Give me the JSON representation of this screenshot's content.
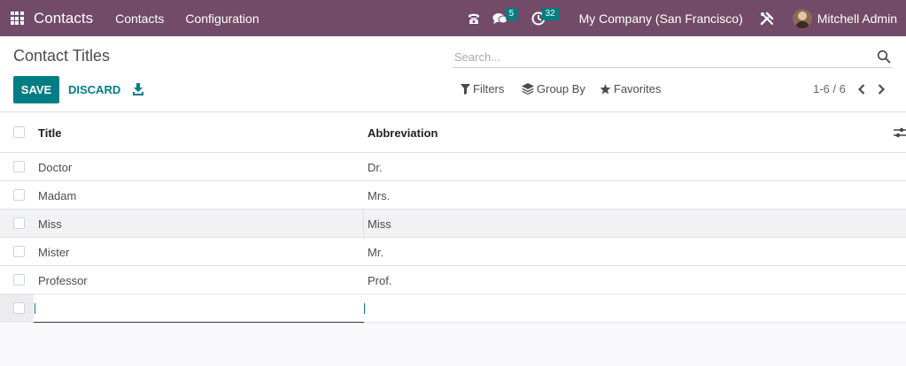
{
  "navbar": {
    "app_name": "Contacts",
    "menus": [
      "Contacts",
      "Configuration"
    ],
    "messages_count": "5",
    "activities_count": "32",
    "company": "My Company (San Francisco)",
    "user": "Mitchell Admin",
    "accent": "#714b67",
    "badge_color": "#017e84"
  },
  "control_panel": {
    "breadcrumb": "Contact Titles",
    "search_placeholder": "Search...",
    "save_label": "SAVE",
    "discard_label": "DISCARD",
    "filters_label": "Filters",
    "group_by_label": "Group By",
    "favorites_label": "Favorites",
    "pager": "1-6 / 6"
  },
  "table": {
    "headers": {
      "title": "Title",
      "abbreviation": "Abbreviation"
    },
    "rows": [
      {
        "title": "Doctor",
        "abbreviation": "Dr."
      },
      {
        "title": "Madam",
        "abbreviation": "Mrs."
      },
      {
        "title": "Miss",
        "abbreviation": "Miss"
      },
      {
        "title": "Mister",
        "abbreviation": "Mr."
      },
      {
        "title": "Professor",
        "abbreviation": "Prof."
      }
    ],
    "new_row": {
      "title": "",
      "abbreviation": ""
    }
  }
}
